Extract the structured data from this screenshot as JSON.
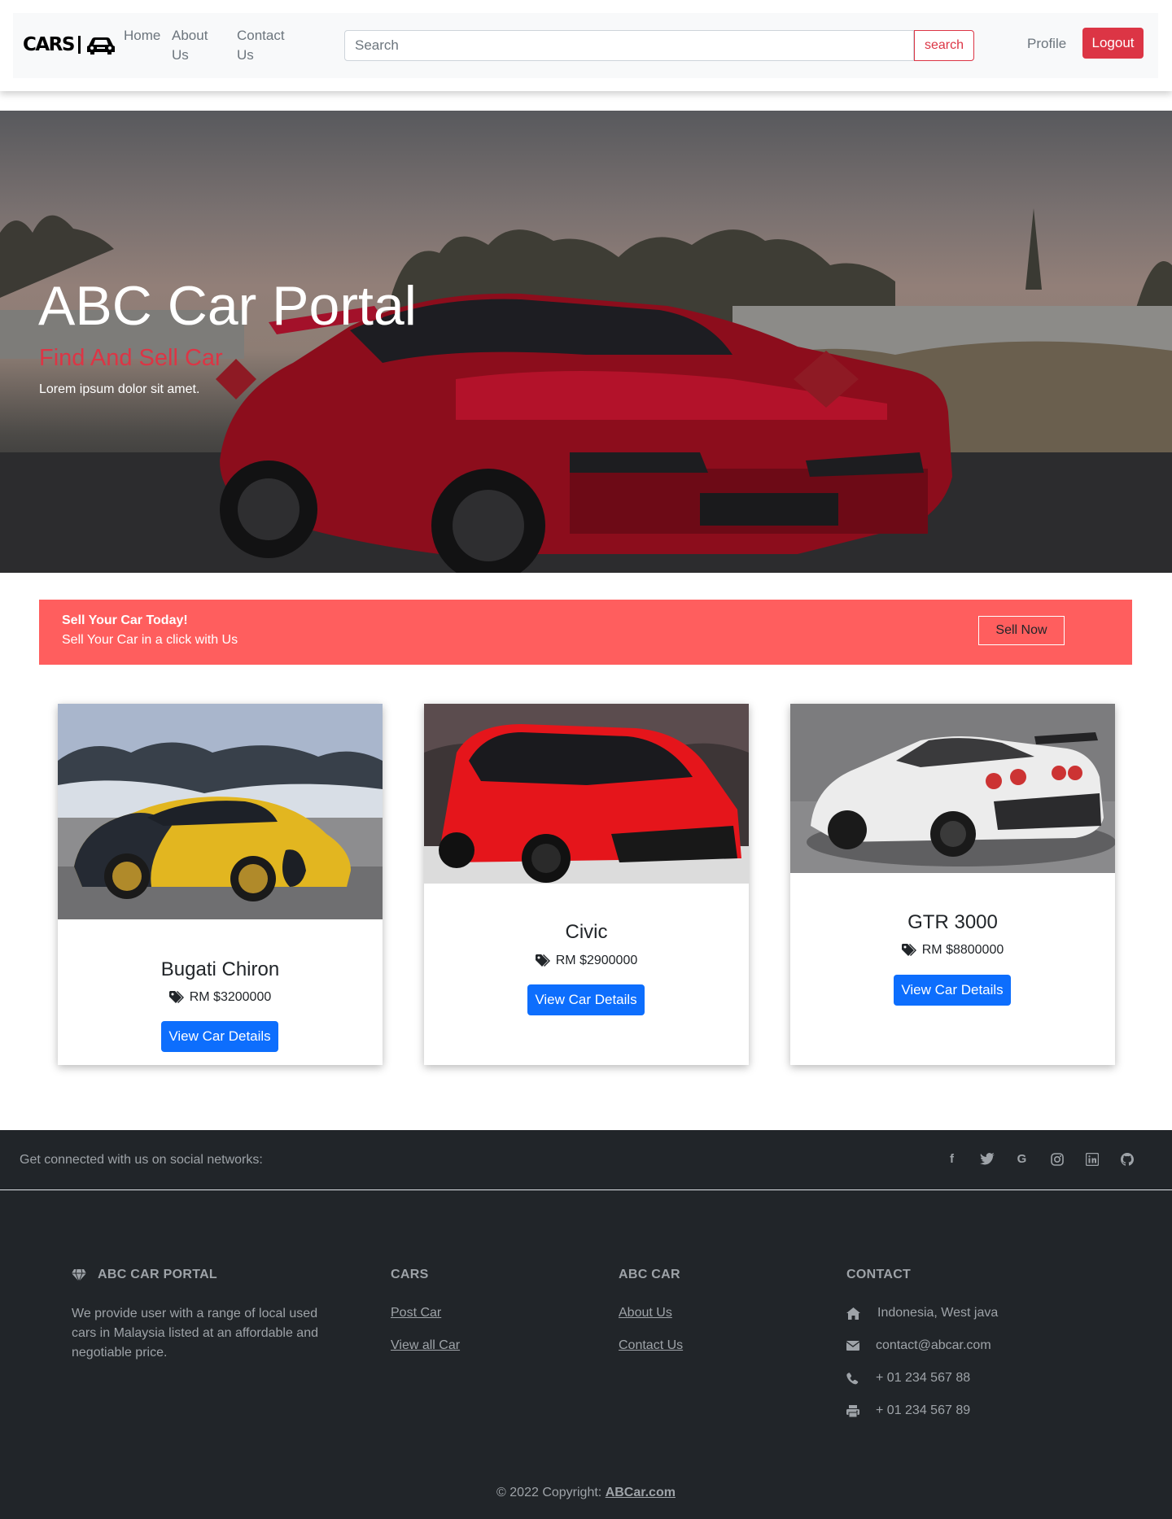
{
  "brand": {
    "name": "CARS",
    "icon": "car-icon"
  },
  "nav": {
    "links": [
      {
        "id": "home",
        "label": "Home"
      },
      {
        "id": "about",
        "label": "About Us"
      },
      {
        "id": "contact",
        "label": "Contact Us"
      }
    ],
    "search_placeholder": "Search",
    "search_button": "search",
    "profile": "Profile",
    "logout": "Logout"
  },
  "hero": {
    "title": "ABC Car Portal",
    "subtitle": "Find And Sell Car",
    "text": "Lorem ipsum dolor sit amet."
  },
  "cta": {
    "title": "Sell Your Car Today!",
    "text": "Sell Your Car in a click with Us",
    "button": "Sell Now"
  },
  "cars": [
    {
      "name": "Bugati Chiron",
      "price": "RM $3200000",
      "button": "View Car Details",
      "price_icon": "tags-icon"
    },
    {
      "name": "Civic",
      "price": "RM $2900000",
      "button": "View Car Details",
      "price_icon": "tags-icon"
    },
    {
      "name": "GTR 3000",
      "price": "RM $8800000",
      "button": "View Car Details",
      "price_icon": "tags-icon"
    }
  ],
  "footer": {
    "social_text": "Get connected with us on social networks:",
    "social_icons": [
      "facebook-icon",
      "twitter-icon",
      "google-icon",
      "instagram-icon",
      "linkedin-icon",
      "github-icon"
    ],
    "about": {
      "heading": "ABC CAR PORTAL",
      "icon": "gem-icon",
      "description": "We provide user with a range of local used cars in Malaysia listed at an affordable and negotiable price."
    },
    "cars": {
      "heading": "CARS",
      "links": [
        "Post Car",
        "View all Car"
      ]
    },
    "abc": {
      "heading": "ABC CAR",
      "links": [
        "About Us",
        "Contact Us"
      ]
    },
    "contact": {
      "heading": "CONTACT",
      "items": [
        {
          "icon": "home-icon",
          "text": "Indonesia, West java"
        },
        {
          "icon": "envelope-icon",
          "text": "contact@abcar.com"
        },
        {
          "icon": "phone-icon",
          "text": "+ 01 234 567 88"
        },
        {
          "icon": "print-icon",
          "text": "+ 01 234 567 89"
        }
      ]
    },
    "copyright_text": "© 2022 Copyright: ",
    "copyright_link": "ABCar.com"
  },
  "colors": {
    "danger": "#dc3545",
    "primary": "#0d6efd",
    "cta_background": "#ff5e5e",
    "footer_background": "#212529"
  }
}
